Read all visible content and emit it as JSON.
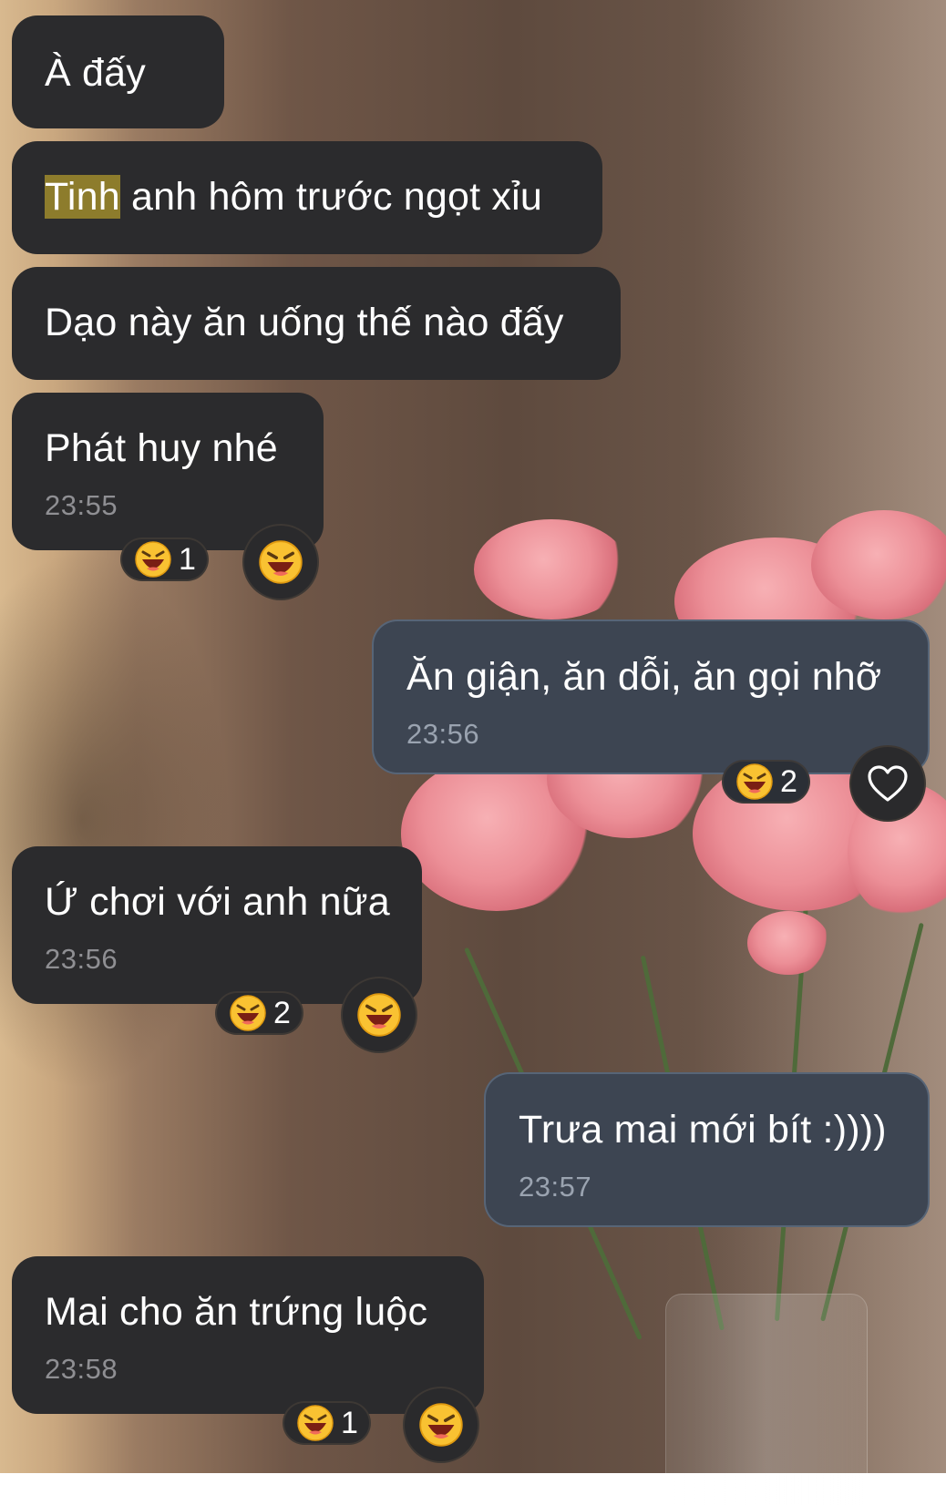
{
  "messages": [
    {
      "text": "À đấy"
    },
    {
      "highlight": "Tinh",
      "text_rest": " anh hôm trước ngọt xỉu"
    },
    {
      "text": "Dạo này ăn uống thế nào đấy"
    },
    {
      "text": "Phát huy nhé",
      "time": "23:55",
      "reaction_count": "1"
    },
    {
      "text": "Ăn giận, ăn dỗi, ăn gọi nhỡ",
      "time": "23:56",
      "reaction_count": "2"
    },
    {
      "text": "Ứ chơi với anh nữa",
      "time": "23:56",
      "reaction_count": "2"
    },
    {
      "text": "Trưa mai mới bít :))))",
      "time": "23:57"
    },
    {
      "text": "Mai cho ăn trứng luộc",
      "time": "23:58",
      "reaction_count": "1"
    }
  ],
  "icons": {
    "reaction_emoji": "laughing-emoji-icon",
    "add_reaction": "heart-outline-icon"
  },
  "colors": {
    "incoming_bubble": "#2b2b2d",
    "outgoing_bubble": "#3d4552",
    "highlight": "#8d7c2c",
    "timestamp": "#8f8f93"
  }
}
